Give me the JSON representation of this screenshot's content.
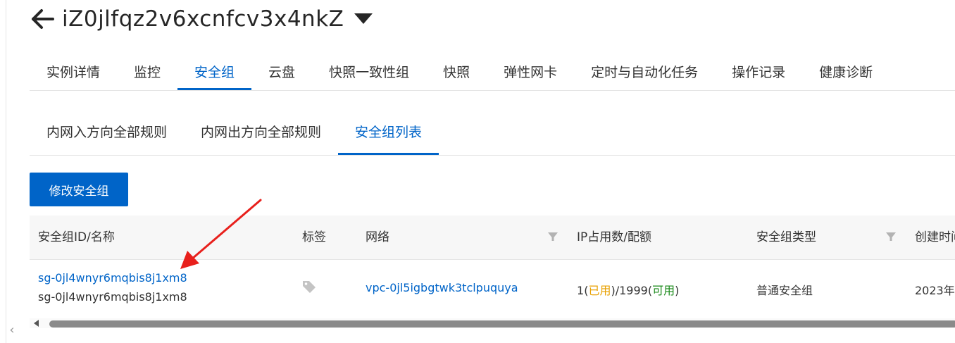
{
  "header": {
    "title": "iZ0jlfqz2v6xcnfcv3x4nkZ",
    "back_icon": "arrow-left-icon",
    "dropdown_icon": "caret-down-icon"
  },
  "tabs": [
    {
      "label": "实例详情",
      "active": false
    },
    {
      "label": "监控",
      "active": false
    },
    {
      "label": "安全组",
      "active": true
    },
    {
      "label": "云盘",
      "active": false
    },
    {
      "label": "快照一致性组",
      "active": false
    },
    {
      "label": "快照",
      "active": false
    },
    {
      "label": "弹性网卡",
      "active": false
    },
    {
      "label": "定时与自动化任务",
      "active": false
    },
    {
      "label": "操作记录",
      "active": false
    },
    {
      "label": "健康诊断",
      "active": false
    }
  ],
  "subtabs": [
    {
      "label": "内网入方向全部规则",
      "active": false
    },
    {
      "label": "内网出方向全部规则",
      "active": false
    },
    {
      "label": "安全组列表",
      "active": true
    }
  ],
  "actions": {
    "modify_label": "修改安全组"
  },
  "table": {
    "columns": [
      "安全组ID/名称",
      "标签",
      "网络",
      "IP占用数/配额",
      "安全组类型",
      "创建时间"
    ],
    "rows": [
      {
        "sg_id": "sg-0jl4wnyr6mqbis8j1xm8",
        "sg_name": "sg-0jl4wnyr6mqbis8j1xm8",
        "network": "vpc-0jl5igbgtwk3tclpuquya",
        "ip_used": "1",
        "ip_used_label": "已用",
        "ip_quota": "1999",
        "ip_avail_label": "可用",
        "type": "普通安全组",
        "created": "2023年"
      }
    ]
  },
  "colors": {
    "accent": "#0064c8",
    "used": "#e8a000",
    "available": "#1a8a1a",
    "annotation": "#e8201c"
  }
}
